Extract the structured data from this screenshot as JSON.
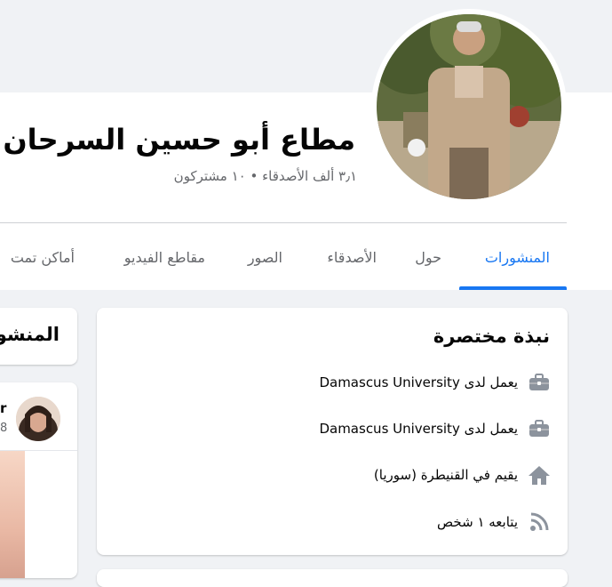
{
  "profile": {
    "name": "مطاع أبو حسين السرحان",
    "stats": "٣٫١ ألف الأصدقاء • ١٠ مشتركون"
  },
  "tabs": [
    {
      "label": "المنشورات",
      "active": true
    },
    {
      "label": "حول"
    },
    {
      "label": "الأصدقاء"
    },
    {
      "label": "الصور"
    },
    {
      "label": "مقاطع الفيديو"
    },
    {
      "label": "أماكن تمت"
    }
  ],
  "intro": {
    "title": "نبذة مختصرة",
    "items": [
      {
        "icon": "briefcase-icon",
        "text": "يعمل لدى Damascus University"
      },
      {
        "icon": "briefcase-icon",
        "text": "يعمل لدى Damascus University"
      },
      {
        "icon": "home-icon",
        "text": "يقيم في القنيطرة (سوريا)"
      },
      {
        "icon": "rss-icon",
        "text": "يتابعه ١ شخص"
      }
    ]
  },
  "posts_card": {
    "title": "المنشو"
  },
  "post": {
    "author_partial": "r",
    "time_partial": "8"
  },
  "colors": {
    "accent": "#1877f2",
    "secondary_text": "#65676b",
    "background": "#f0f2f5"
  }
}
